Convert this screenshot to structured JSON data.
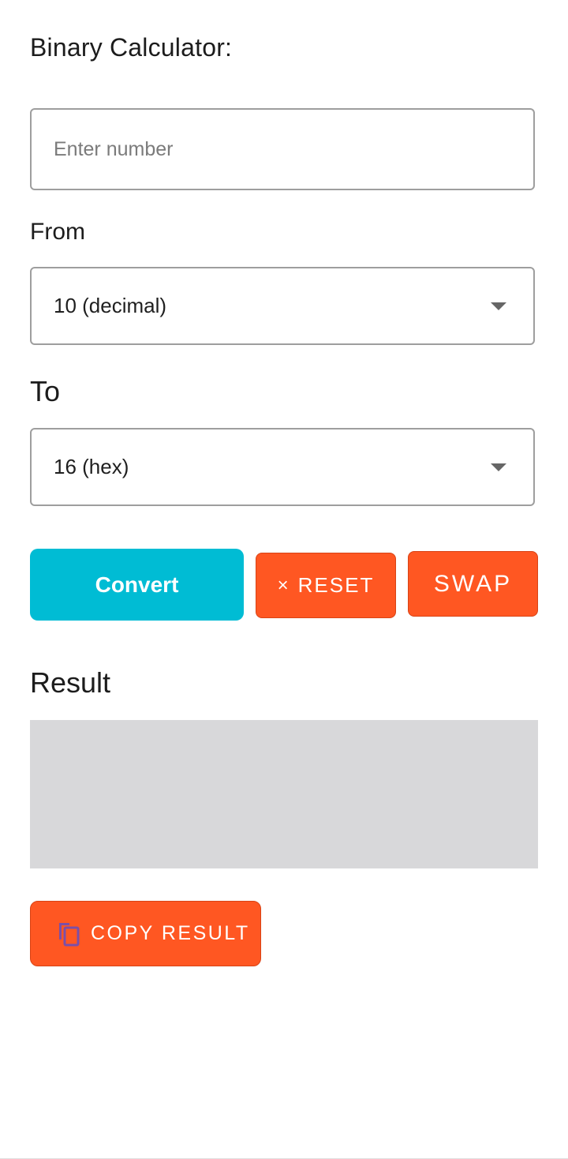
{
  "header": {
    "title": "Binary Calculator:"
  },
  "input": {
    "value": "",
    "placeholder": "Enter number"
  },
  "from": {
    "label": "From",
    "selected": "10 (decimal)"
  },
  "to": {
    "label": "To",
    "selected": "16 (hex)"
  },
  "buttons": {
    "convert_label": "Convert",
    "reset_icon": "×",
    "reset_label": "RESET",
    "swap_label": "SWAP",
    "copy_label": "COPY RESULT",
    "copy_icon": "copy-icon"
  },
  "result": {
    "label": "Result",
    "value": ""
  },
  "colors": {
    "convert": "#00bcd4",
    "action": "#ff5722",
    "result_bg": "#d8d8da",
    "copy_icon": "#7b4fa8"
  }
}
